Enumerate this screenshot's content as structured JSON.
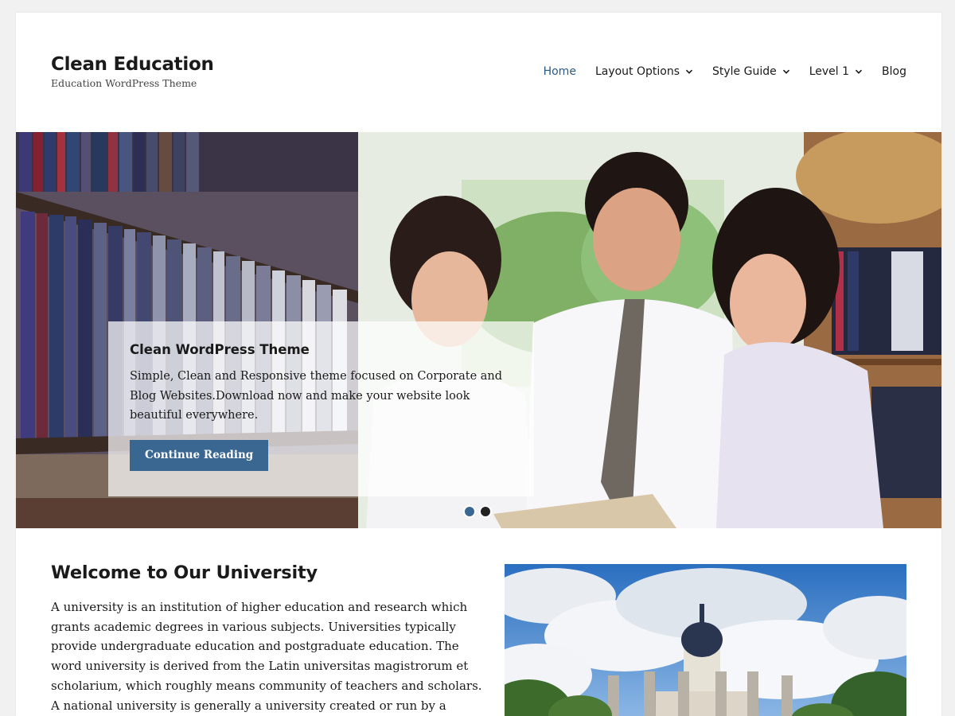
{
  "site": {
    "title": "Clean Education",
    "description": "Education WordPress Theme"
  },
  "nav": {
    "items": [
      {
        "label": "Home",
        "active": true,
        "has_submenu": false
      },
      {
        "label": "Layout Options",
        "active": false,
        "has_submenu": true
      },
      {
        "label": "Style Guide",
        "active": false,
        "has_submenu": true
      },
      {
        "label": "Level 1",
        "active": false,
        "has_submenu": true
      },
      {
        "label": "Blog",
        "active": false,
        "has_submenu": false
      }
    ]
  },
  "slider": {
    "caption_title": "Clean WordPress Theme",
    "caption_text": "Simple, Clean and Responsive theme focused on Corporate and Blog Websites.Download now and make your website look beautiful everywhere.",
    "button_label": "Continue Reading",
    "active_slide": 1,
    "slide_count": 2
  },
  "content": {
    "title": "Welcome to Our University",
    "text": "A university is an institution of higher education and research which grants academic degrees in various subjects. Universities typically provide undergraduate education and postgraduate education. The word university is derived from the Latin universitas magistrorum et scholarium, which roughly means community of teachers and scholars. A national university is generally a university created or run by a national state."
  },
  "colors": {
    "accent": "#3a6792",
    "nav_active": "#2c5a86",
    "text": "#1a1a1a",
    "background": "#f1f1f1"
  },
  "icons": {
    "submenu": "chevron-down-icon"
  }
}
